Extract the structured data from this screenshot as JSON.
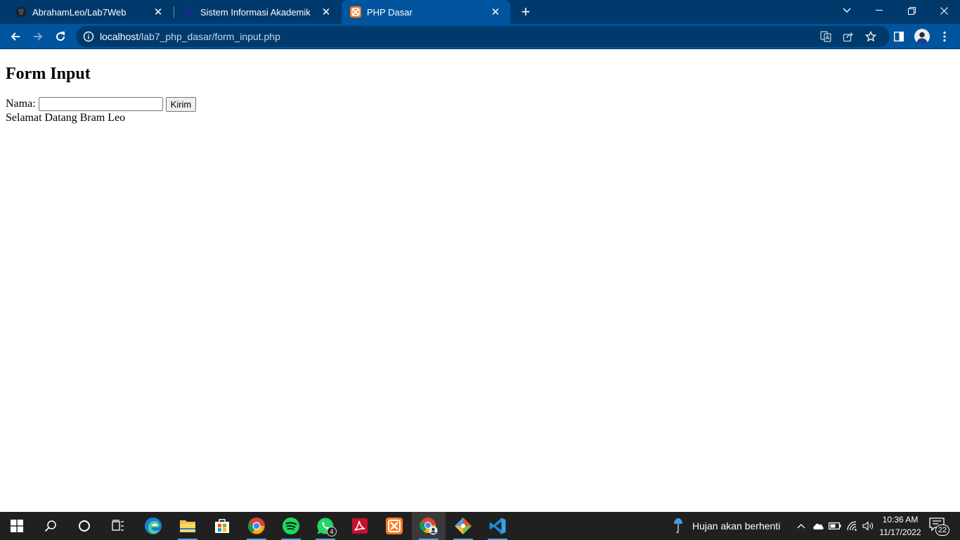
{
  "browser": {
    "tabs": [
      {
        "label": "AbrahamLeo/Lab7Web",
        "favicon": "github-icon",
        "active": false
      },
      {
        "label": "Sistem Informasi Akademik",
        "favicon": "university-icon",
        "active": false
      },
      {
        "label": "PHP Dasar",
        "favicon": "xampp-icon",
        "active": true
      }
    ],
    "close_glyph": "✕",
    "newtab_glyph": "+",
    "window_controls": {
      "tab_search": "⌵",
      "minimize": "—",
      "restore": "❐",
      "close": "✕"
    },
    "nav": {
      "back": "←",
      "forward": "→",
      "reload": "↻"
    },
    "url_host": "localhost",
    "url_path": "/lab7_php_dasar/form_input.php",
    "accent": "#00559e",
    "frame": "#003a6c"
  },
  "page": {
    "heading": "Form Input",
    "name_label": "Nama:",
    "name_value": "",
    "submit_label": "Kirim",
    "greeting": "Selamat Datang Bram Leo"
  },
  "taskbar": {
    "apps": [
      "start-icon",
      "search-icon",
      "cortana-icon",
      "task-view-icon",
      "edge-icon",
      "file-explorer-icon",
      "ms-store-icon",
      "chrome-icon",
      "spotify-icon",
      "whatsapp-icon",
      "acrobat-icon",
      "xampp-icon",
      "chrome-profile-icon",
      "git-icon",
      "vscode-icon"
    ],
    "whatsapp_badge": "4",
    "weather_text": "Hujan akan berhenti",
    "time": "10:36 AM",
    "date": "11/17/2022",
    "notification_count": "22",
    "tray_chevron": "^"
  }
}
